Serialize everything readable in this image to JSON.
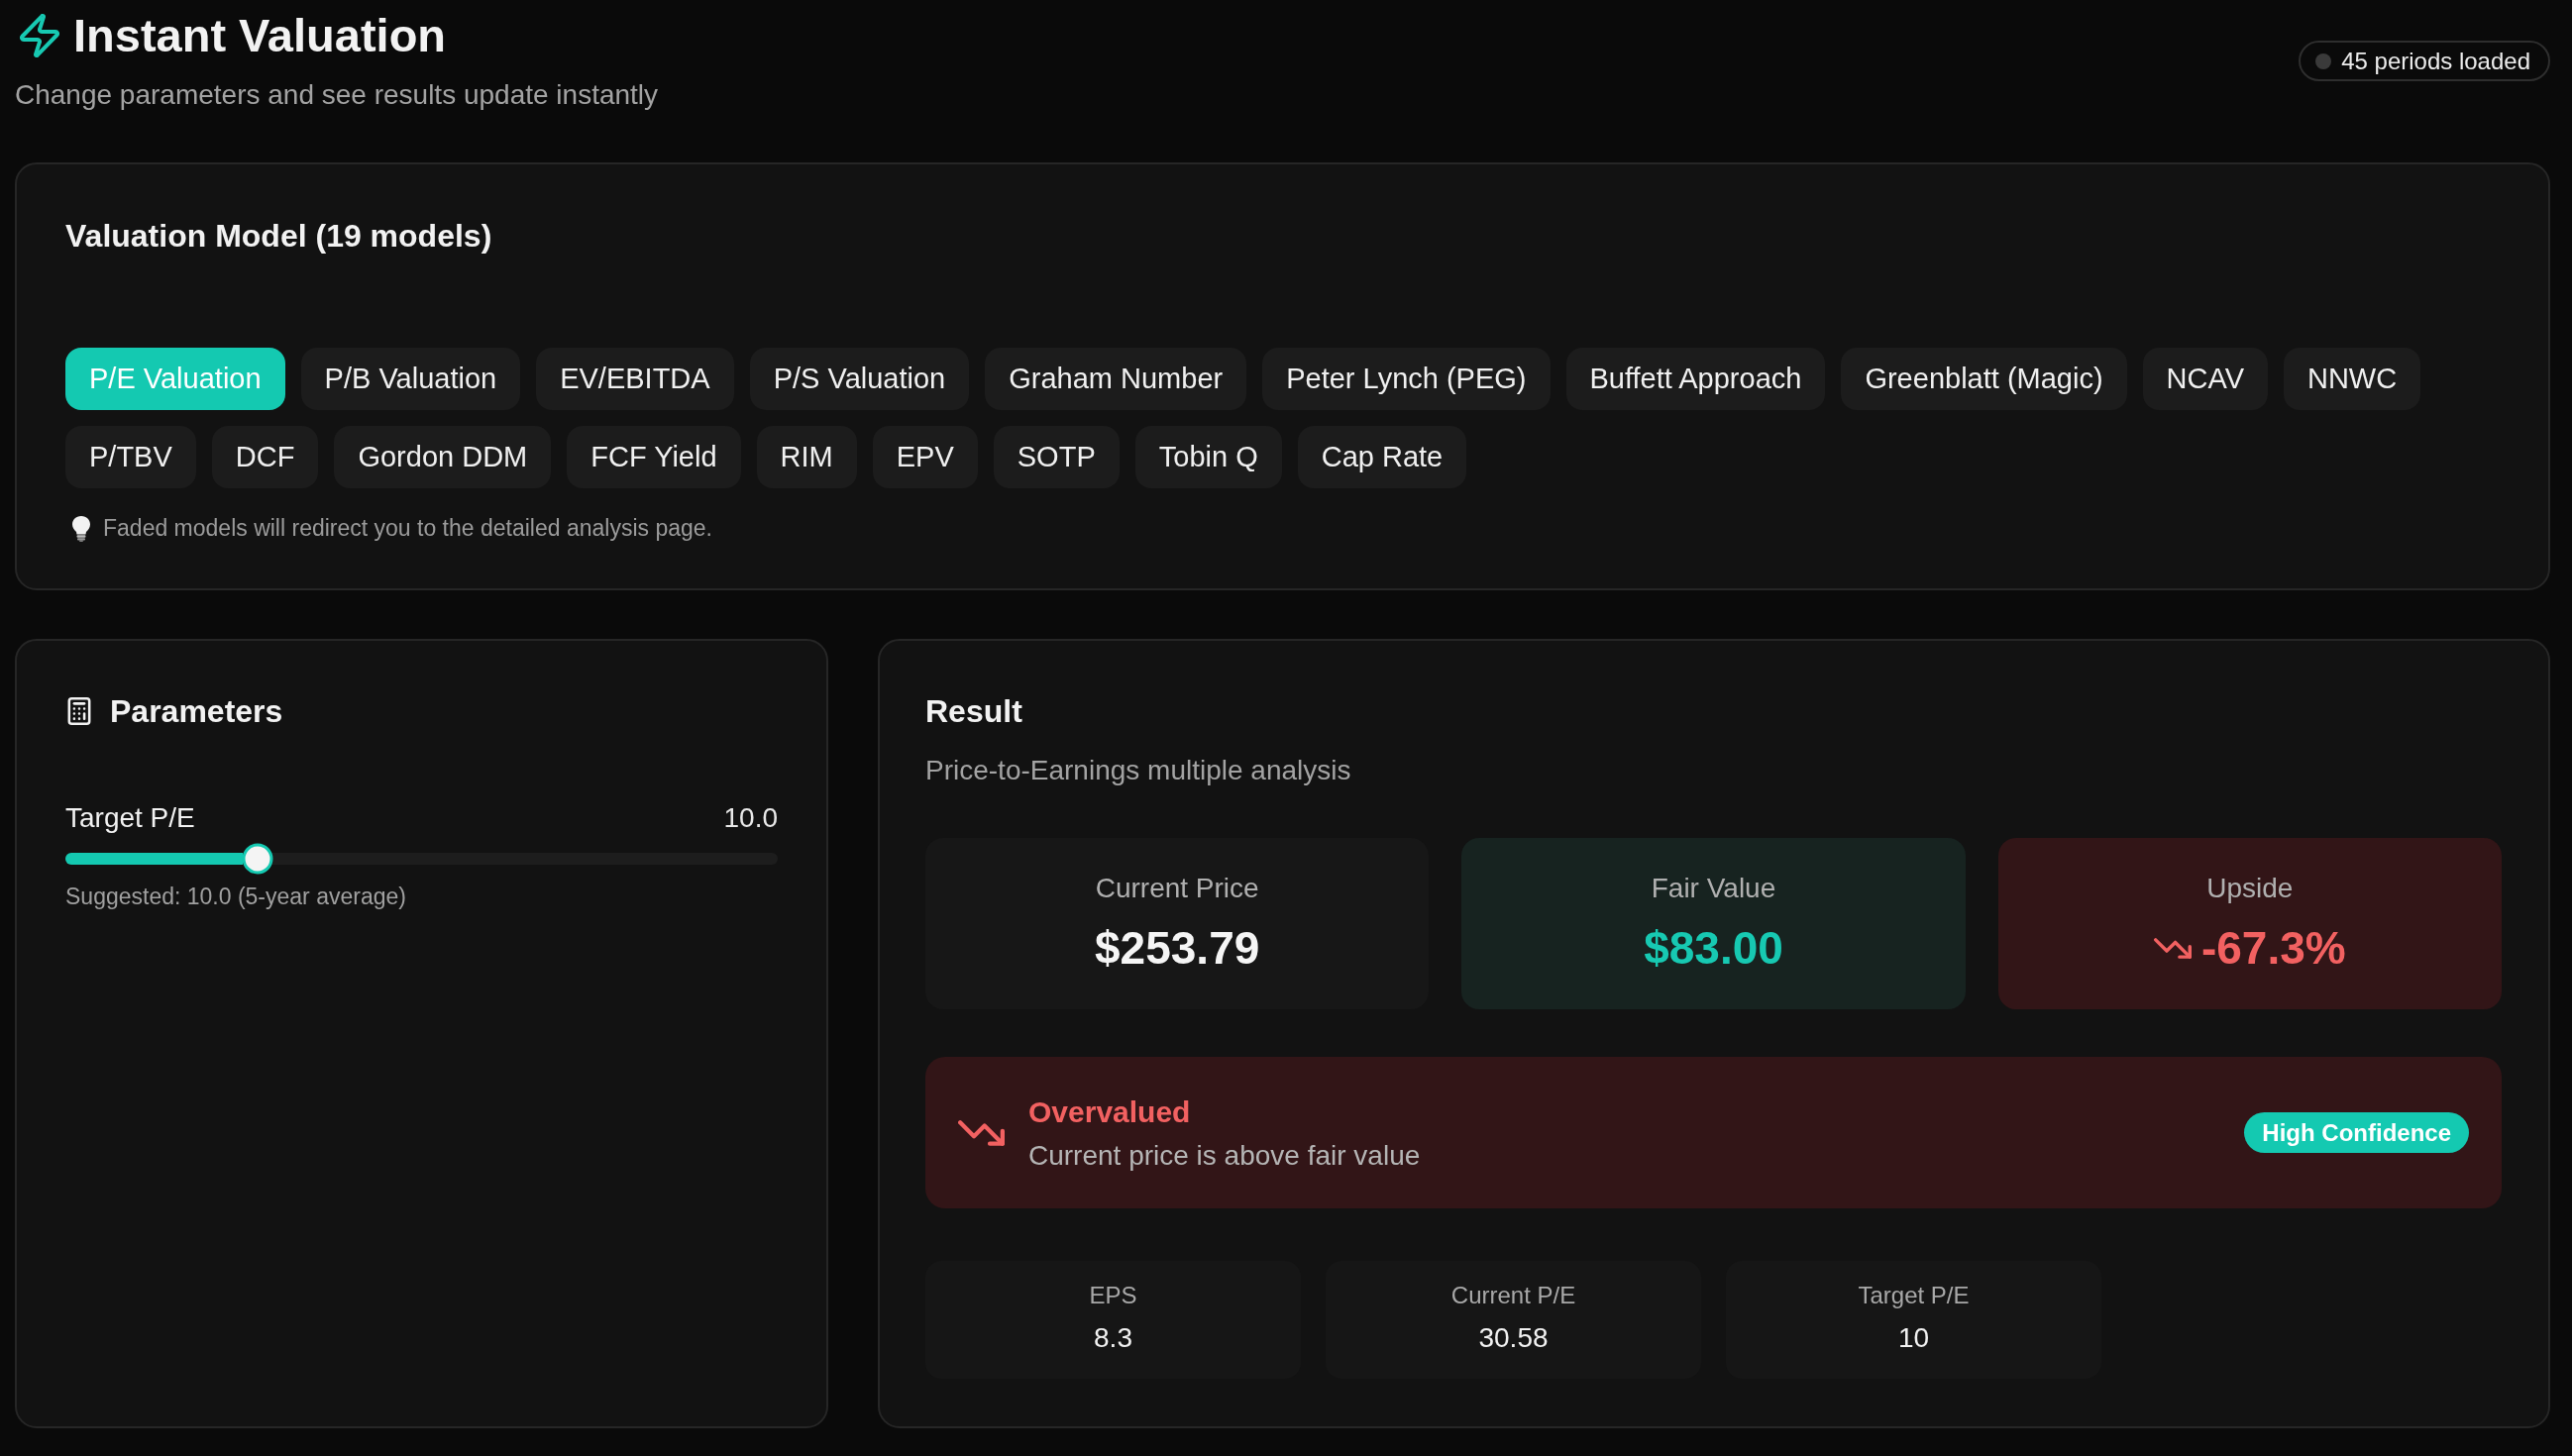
{
  "header": {
    "title": "Instant Valuation",
    "subtitle": "Change parameters and see results update instantly",
    "status_badge": "45 periods loaded"
  },
  "model_picker": {
    "title": "Valuation Model (19 models)",
    "models": [
      {
        "label": "P/E Valuation",
        "selected": true
      },
      {
        "label": "P/B Valuation",
        "selected": false
      },
      {
        "label": "EV/EBITDA",
        "selected": false
      },
      {
        "label": "P/S Valuation",
        "selected": false
      },
      {
        "label": "Graham Number",
        "selected": false
      },
      {
        "label": "Peter Lynch (PEG)",
        "selected": false
      },
      {
        "label": "Buffett Approach",
        "selected": false
      },
      {
        "label": "Greenblatt (Magic)",
        "selected": false
      },
      {
        "label": "NCAV",
        "selected": false
      },
      {
        "label": "NNWC",
        "selected": false
      },
      {
        "label": "P/TBV",
        "selected": false
      },
      {
        "label": "DCF",
        "selected": false
      },
      {
        "label": "Gordon DDM",
        "selected": false
      },
      {
        "label": "FCF Yield",
        "selected": false
      },
      {
        "label": "RIM",
        "selected": false
      },
      {
        "label": "EPV",
        "selected": false
      },
      {
        "label": "SOTP",
        "selected": false
      },
      {
        "label": "Tobin Q",
        "selected": false
      },
      {
        "label": "Cap Rate",
        "selected": false
      }
    ],
    "hint": "Faded models will redirect you to the detailed analysis page."
  },
  "parameters": {
    "title": "Parameters",
    "sliders": [
      {
        "label": "Target P/E",
        "reading": "10.0",
        "level": 0.27,
        "note": "Suggested: 10.0 (5-year average)"
      }
    ]
  },
  "result": {
    "title": "Result",
    "subtitle": "Price-to-Earnings multiple analysis",
    "summary_cards": [
      {
        "label": "Current Price",
        "value": "$253.79",
        "kind": "neutral",
        "falling": false
      },
      {
        "label": "Fair Value",
        "value": "$83.00",
        "kind": "positive",
        "falling": false
      },
      {
        "label": "Upside",
        "value": "-67.3%",
        "kind": "negative",
        "falling": true
      }
    ],
    "verdict": {
      "title": "Overvalued",
      "description": "Current price is above fair value",
      "kind": "negative",
      "confidence": "High Confidence"
    },
    "metrics": [
      {
        "label": "EPS",
        "value": "8.3"
      },
      {
        "label": "Current P/E",
        "value": "30.58"
      },
      {
        "label": "Target P/E",
        "value": "10"
      }
    ]
  }
}
